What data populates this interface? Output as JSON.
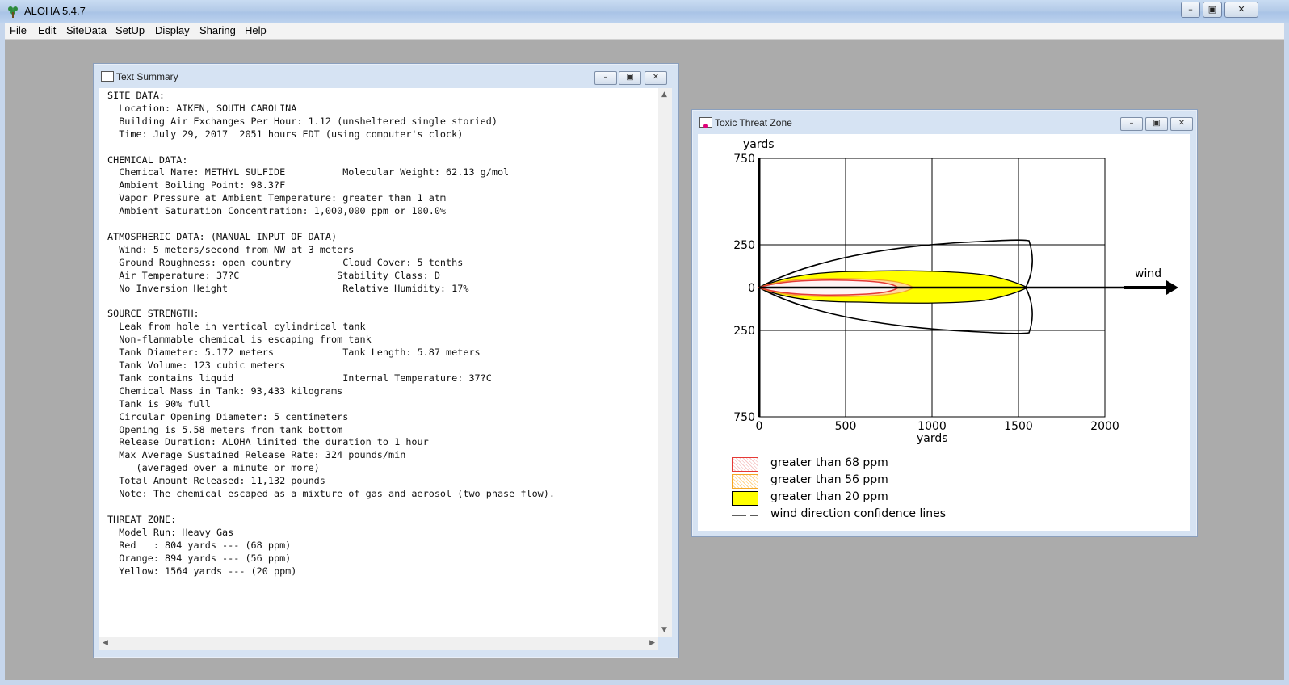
{
  "app": {
    "title": "ALOHA 5.4.7",
    "controls": [
      "minimize",
      "maximize",
      "close"
    ]
  },
  "menu": [
    "File",
    "Edit",
    "SiteData",
    "SetUp",
    "Display",
    "Sharing",
    "Help"
  ],
  "summary_window": {
    "title": "Text Summary",
    "lines": [
      "SITE DATA:",
      "  Location: AIKEN, SOUTH CAROLINA",
      "  Building Air Exchanges Per Hour: 1.12 (unsheltered single storied)",
      "  Time: July 29, 2017  2051 hours EDT (using computer's clock)",
      "",
      "CHEMICAL DATA:",
      "  Chemical Name: METHYL SULFIDE          Molecular Weight: 62.13 g/mol",
      "  Ambient Boiling Point: 98.3?F",
      "  Vapor Pressure at Ambient Temperature: greater than 1 atm",
      "  Ambient Saturation Concentration: 1,000,000 ppm or 100.0%",
      "",
      "ATMOSPHERIC DATA: (MANUAL INPUT OF DATA)",
      "  Wind: 5 meters/second from NW at 3 meters",
      "  Ground Roughness: open country         Cloud Cover: 5 tenths",
      "  Air Temperature: 37?C                 Stability Class: D",
      "  No Inversion Height                    Relative Humidity: 17%",
      "",
      "SOURCE STRENGTH:",
      "  Leak from hole in vertical cylindrical tank",
      "  Non-flammable chemical is escaping from tank",
      "  Tank Diameter: 5.172 meters            Tank Length: 5.87 meters",
      "  Tank Volume: 123 cubic meters",
      "  Tank contains liquid                   Internal Temperature: 37?C",
      "  Chemical Mass in Tank: 93,433 kilograms",
      "  Tank is 90% full",
      "  Circular Opening Diameter: 5 centimeters",
      "  Opening is 5.58 meters from tank bottom",
      "  Release Duration: ALOHA limited the duration to 1 hour",
      "  Max Average Sustained Release Rate: 324 pounds/min",
      "     (averaged over a minute or more)",
      "  Total Amount Released: 11,132 pounds",
      "  Note: The chemical escaped as a mixture of gas and aerosol (two phase flow).",
      "",
      "THREAT ZONE:",
      "  Model Run: Heavy Gas",
      "  Red   : 804 yards --- (68 ppm)",
      "  Orange: 894 yards --- (56 ppm)",
      "  Yellow: 1564 yards --- (20 ppm)"
    ]
  },
  "threat_window": {
    "title": "Toxic Threat Zone",
    "y_axis_label": "yards",
    "x_axis_label": "yards",
    "y_ticks": [
      "750",
      "250",
      "0",
      "250",
      "750"
    ],
    "x_ticks": [
      "0",
      "500",
      "1000",
      "1500",
      "2000"
    ],
    "wind_label": "wind",
    "legend": [
      {
        "label": "greater than 68 ppm",
        "color": "#e53935"
      },
      {
        "label": "greater than 56 ppm",
        "color": "#f5a623"
      },
      {
        "label": "greater than 20 ppm",
        "color": "#ffff00"
      },
      {
        "label": "wind direction confidence lines",
        "color": "#000000"
      }
    ],
    "zones": {
      "red_yards": 804,
      "orange_yards": 894,
      "yellow_yards": 1564
    }
  }
}
